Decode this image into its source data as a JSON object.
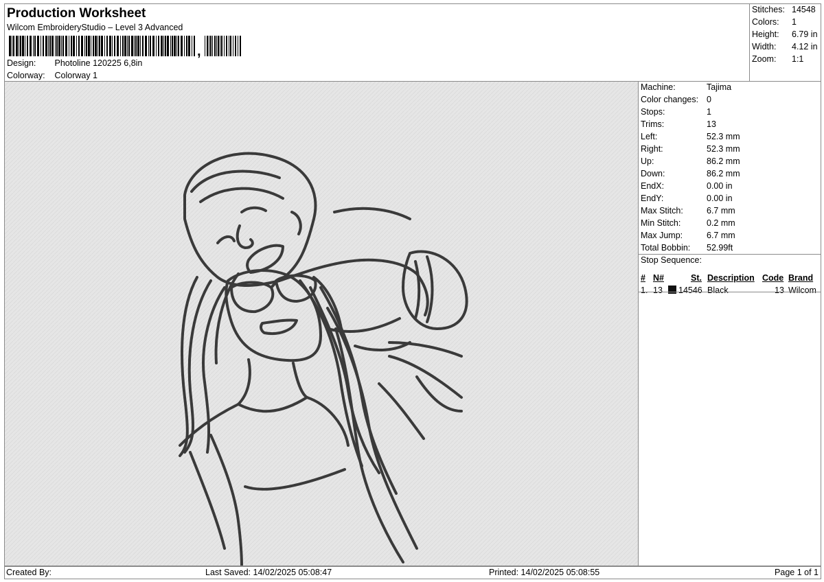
{
  "header": {
    "title": "Production Worksheet",
    "subtitle": "Wilcom EmbroideryStudio – Level 3 Advanced",
    "barcode_suffix": ",",
    "design_label": "Design:",
    "design_value": "Photoline 120225 6,8in",
    "colorway_label": "Colorway:",
    "colorway_value": "Colorway 1"
  },
  "summary": [
    {
      "key": "Stitches:",
      "value": "14548"
    },
    {
      "key": "Colors:",
      "value": "1"
    },
    {
      "key": "Height:",
      "value": "6.79 in"
    },
    {
      "key": "Width:",
      "value": "4.12 in"
    },
    {
      "key": "Zoom:",
      "value": "1:1"
    }
  ],
  "machine_info": [
    {
      "key": "Machine:",
      "value": "Tajima"
    },
    {
      "key": "Color changes:",
      "value": "0"
    },
    {
      "key": "Stops:",
      "value": "1"
    },
    {
      "key": "Trims:",
      "value": "13"
    },
    {
      "key": "Left:",
      "value": "52.3 mm"
    },
    {
      "key": "Right:",
      "value": "52.3 mm"
    },
    {
      "key": "Up:",
      "value": "86.2 mm"
    },
    {
      "key": "Down:",
      "value": "86.2 mm"
    },
    {
      "key": "EndX:",
      "value": "0.00 in"
    },
    {
      "key": "EndY:",
      "value": "0.00 in"
    },
    {
      "key": "Max Stitch:",
      "value": "6.7 mm"
    },
    {
      "key": "Min Stitch:",
      "value": "0.2 mm"
    },
    {
      "key": "Max Jump:",
      "value": "6.7 mm"
    },
    {
      "key": "Total Bobbin:",
      "value": "52.99ft"
    }
  ],
  "stop_sequence": {
    "label": "Stop Sequence:",
    "columns": [
      "#",
      "N#",
      "St.",
      "Description",
      "Code",
      "Brand"
    ],
    "rows": [
      {
        "index": "1.",
        "needle": "13",
        "color": "#111111",
        "stitches": "14546",
        "description": "Black",
        "code": "13",
        "brand": "Wilcom"
      }
    ]
  },
  "footer": {
    "created_by": "Created By:",
    "last_saved": "Last Saved: 14/02/2025 05:08:47",
    "printed": "Printed: 14/02/2025 05:08:55",
    "page": "Page 1 of 1"
  },
  "colors": {
    "thread": "#3a3a3a",
    "canvas": "#e4e4e4",
    "border": "#8a8a8a"
  }
}
